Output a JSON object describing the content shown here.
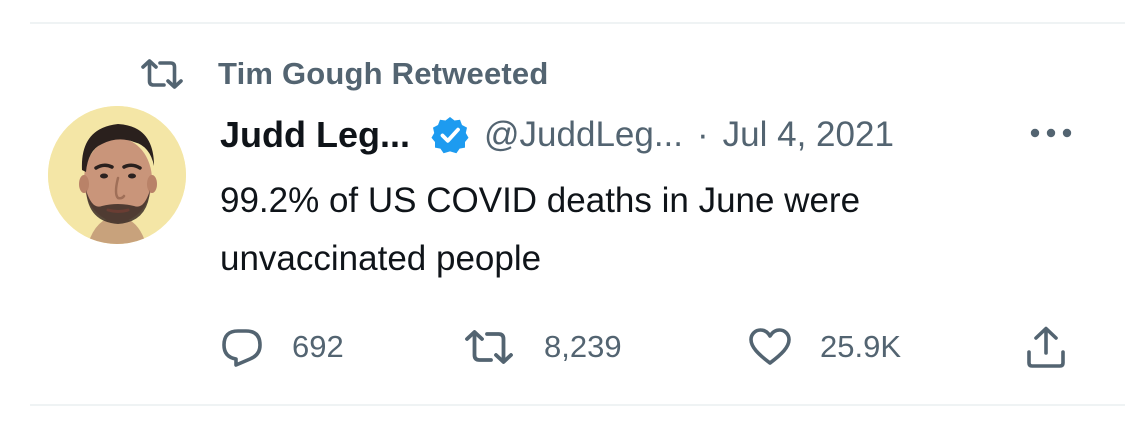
{
  "social_context": {
    "icon": "retweet-icon",
    "text": "Tim Gough Retweeted"
  },
  "author": {
    "display_name": "Judd Leg...",
    "verified": true,
    "handle": "@JuddLeg...",
    "separator": "·",
    "date": "Jul 4, 2021"
  },
  "tweet": {
    "line1": "99.2% of US COVID deaths in June were",
    "line2": "unvaccinated people"
  },
  "actions": {
    "replies": "692",
    "retweets": "8,239",
    "likes": "25.9K"
  },
  "colors": {
    "text_primary": "#0f1419",
    "text_secondary": "#536471",
    "verified_blue": "#1d9bf0",
    "divider": "#eff3f4"
  }
}
